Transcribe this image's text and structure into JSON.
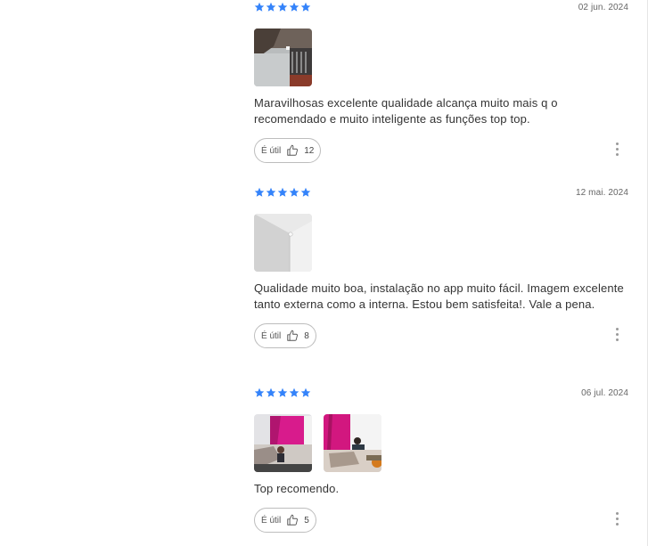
{
  "colors": {
    "star": "#3483fa",
    "text": "#333333",
    "date": "#666666",
    "border": "#bdbdbd"
  },
  "reviews": [
    {
      "rating": 5,
      "date": "02 jun. 2024",
      "photo_count": 1,
      "text": "Maravilhosas excelente qualidade alcança muito mais q o recomendado e muito inteligente as funções top top.",
      "useful_label": "É útil",
      "useful_count": "12"
    },
    {
      "rating": 5,
      "date": "12 mai. 2024",
      "photo_count": 1,
      "text": "Qualidade muito boa, instalação no app muito fácil. Imagem excelente tanto externa como a interna. Estou bem satisfeita!. Vale a pena.",
      "useful_label": "É útil",
      "useful_count": "8"
    },
    {
      "rating": 5,
      "date": "06 jul. 2024",
      "photo_count": 2,
      "text": "Top recomendo.",
      "useful_label": "É útil",
      "useful_count": "5"
    }
  ]
}
